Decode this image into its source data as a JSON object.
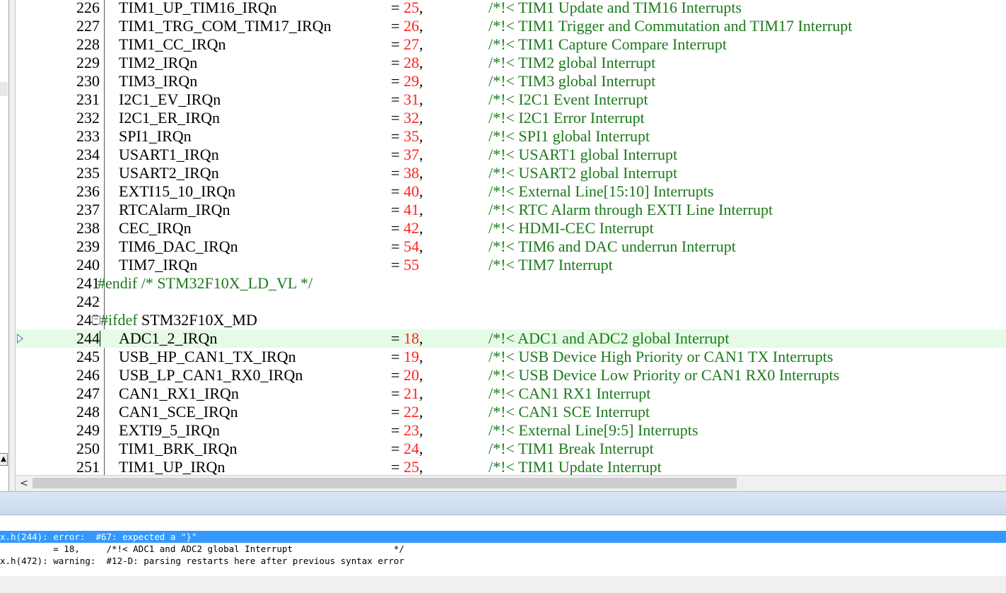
{
  "editor": {
    "lines": [
      {
        "ln": "226",
        "ident": "TIM1_UP_TIM16_IRQn",
        "eq": "= ",
        "num": "25",
        "tail": ",",
        "comment": "/*!< TIM1 Update and TIM16 Interrupts"
      },
      {
        "ln": "227",
        "ident": "TIM1_TRG_COM_TIM17_IRQn",
        "eq": "= ",
        "num": "26",
        "tail": ",",
        "comment": "/*!< TIM1 Trigger and Commutation and TIM17 Interrupt"
      },
      {
        "ln": "228",
        "ident": "TIM1_CC_IRQn",
        "eq": "= ",
        "num": "27",
        "tail": ",",
        "comment": "/*!< TIM1 Capture Compare Interrupt"
      },
      {
        "ln": "229",
        "ident": "TIM2_IRQn",
        "eq": "= ",
        "num": "28",
        "tail": ",",
        "comment": "/*!< TIM2 global Interrupt"
      },
      {
        "ln": "230",
        "ident": "TIM3_IRQn",
        "eq": "= ",
        "num": "29",
        "tail": ",",
        "comment": "/*!< TIM3 global Interrupt"
      },
      {
        "ln": "231",
        "ident": "I2C1_EV_IRQn",
        "eq": "= ",
        "num": "31",
        "tail": ",",
        "comment": "/*!< I2C1 Event Interrupt"
      },
      {
        "ln": "232",
        "ident": "I2C1_ER_IRQn",
        "eq": "= ",
        "num": "32",
        "tail": ",",
        "comment": "/*!< I2C1 Error Interrupt"
      },
      {
        "ln": "233",
        "ident": "SPI1_IRQn",
        "eq": "= ",
        "num": "35",
        "tail": ",",
        "comment": "/*!< SPI1 global Interrupt"
      },
      {
        "ln": "234",
        "ident": "USART1_IRQn",
        "eq": "= ",
        "num": "37",
        "tail": ",",
        "comment": "/*!< USART1 global Interrupt"
      },
      {
        "ln": "235",
        "ident": "USART2_IRQn",
        "eq": "= ",
        "num": "38",
        "tail": ",",
        "comment": "/*!< USART2 global Interrupt"
      },
      {
        "ln": "236",
        "ident": "EXTI15_10_IRQn",
        "eq": "= ",
        "num": "40",
        "tail": ",",
        "comment": "/*!< External Line[15:10] Interrupts"
      },
      {
        "ln": "237",
        "ident": "RTCAlarm_IRQn",
        "eq": "= ",
        "num": "41",
        "tail": ",",
        "comment": "/*!< RTC Alarm through EXTI Line Interrupt"
      },
      {
        "ln": "238",
        "ident": "CEC_IRQn",
        "eq": "= ",
        "num": "42",
        "tail": ",",
        "comment": "/*!< HDMI-CEC Interrupt"
      },
      {
        "ln": "239",
        "ident": "TIM6_DAC_IRQn",
        "eq": "= ",
        "num": "54",
        "tail": ",",
        "comment": "/*!< TIM6 and DAC underrun Interrupt"
      },
      {
        "ln": "240",
        "ident": "TIM7_IRQn",
        "eq": "= ",
        "num": "55",
        "tail": "",
        "comment": "/*!< TIM7 Interrupt"
      },
      {
        "ln": "241",
        "pp": "#endif /* STM32F10X_LD_VL */"
      },
      {
        "ln": "242",
        "pp": ""
      },
      {
        "ln": "243",
        "ppkw": "#ifdef",
        "pprest": " STM32F10X_MD"
      },
      {
        "ln": "244",
        "ident": "ADC1_2_IRQn",
        "eq": "= ",
        "num": "18",
        "tail": ",",
        "comment": "/*!< ADC1 and ADC2 global Interrupt"
      },
      {
        "ln": "245",
        "ident": "USB_HP_CAN1_TX_IRQn",
        "eq": "= ",
        "num": "19",
        "tail": ",",
        "comment": "/*!< USB Device High Priority or CAN1 TX Interrupts"
      },
      {
        "ln": "246",
        "ident": "USB_LP_CAN1_RX0_IRQn",
        "eq": "= ",
        "num": "20",
        "tail": ",",
        "comment": "/*!< USB Device Low Priority or CAN1 RX0 Interrupts"
      },
      {
        "ln": "247",
        "ident": "CAN1_RX1_IRQn",
        "eq": "= ",
        "num": "21",
        "tail": ",",
        "comment": "/*!< CAN1 RX1 Interrupt"
      },
      {
        "ln": "248",
        "ident": "CAN1_SCE_IRQn",
        "eq": "= ",
        "num": "22",
        "tail": ",",
        "comment": "/*!< CAN1 SCE Interrupt"
      },
      {
        "ln": "249",
        "ident": "EXTI9_5_IRQn",
        "eq": "= ",
        "num": "23",
        "tail": ",",
        "comment": "/*!< External Line[9:5] Interrupts"
      },
      {
        "ln": "250",
        "ident": "TIM1_BRK_IRQn",
        "eq": "= ",
        "num": "24",
        "tail": ",",
        "comment": "/*!< TIM1 Break Interrupt"
      },
      {
        "ln": "251",
        "ident": "TIM1_UP_IRQn",
        "eq": "= ",
        "num": "25",
        "tail": ",",
        "comment": "/*!< TIM1 Update Interrupt"
      }
    ],
    "current_line": "244",
    "colors": {
      "number": "#ff2020",
      "comment": "#1a7a1a",
      "current_line_bg": "#e6fbe6"
    }
  },
  "scrollbar": {
    "left_arrow": "<"
  },
  "build_output": {
    "lines": [
      "x.h(244): error:  #67: expected a \"}\"",
      "          = 18,     /*!< ADC1 and ADC2 global Interrupt                   */",
      "x.h(472): warning:  #12-D: parsing restarts here after previous syntax error"
    ],
    "selected_index": 0,
    "colors": {
      "selection_bg": "#3399ff"
    }
  }
}
